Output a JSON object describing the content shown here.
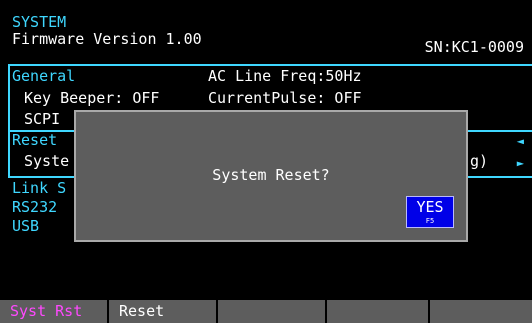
{
  "header": {
    "title": "SYSTEM",
    "firmware": "Firmware Version 1.00",
    "serial": "SN:KC1-0009"
  },
  "general": {
    "title": "General",
    "ac_line_freq": "AC Line Freq:50Hz",
    "key_beeper": "Key Beeper: OFF",
    "current_pulse": "CurrentPulse: OFF",
    "scpi": "SCPI"
  },
  "reset": {
    "title": "Reset",
    "system_text": "Syste",
    "partial_right": "g)"
  },
  "link": {
    "title": "Link S",
    "rs232": "RS232",
    "usb": "USB"
  },
  "dialog": {
    "message": "System Reset?",
    "yes_label": "YES",
    "yes_key": "F5"
  },
  "softkeys": [
    {
      "label": "Syst Rst"
    },
    {
      "label": "Reset"
    },
    {
      "label": ""
    },
    {
      "label": ""
    },
    {
      "label": ""
    }
  ],
  "colors": {
    "accent": "#3fd7ff",
    "highlight": "#ff49ff",
    "dialog_bg": "#5d5d5d",
    "yes_button": "#0000e8"
  }
}
